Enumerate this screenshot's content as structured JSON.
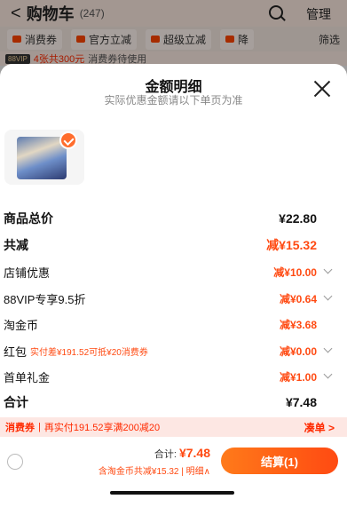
{
  "cart_header": {
    "back": "<",
    "title": "购物车",
    "count": "(247)",
    "manage": "管理"
  },
  "filters": {
    "items": [
      "消费券",
      "官方立减",
      "超级立减",
      "降"
    ],
    "more": "筛选"
  },
  "coupon_banner": {
    "tag": "88VIP",
    "red": "4张共300元",
    "text": "消费券待使用"
  },
  "sheet": {
    "title": "金额明细",
    "subtitle": "实际优惠金额请以下单页为准",
    "rows": [
      {
        "label": "商品总价",
        "value": "¥22.80"
      },
      {
        "label": "共减",
        "value": "减¥15.32"
      },
      {
        "label": "店铺优惠",
        "value": "减¥10.00"
      },
      {
        "label": "88VIP专享9.5折",
        "value": "减¥0.64"
      },
      {
        "label": "淘金币",
        "value": "减¥3.68"
      },
      {
        "label": "红包",
        "note": "实付差¥191.52可抵¥20消费券",
        "value": "减¥0.00"
      },
      {
        "label": "首单礼金",
        "value": "减¥1.00"
      },
      {
        "label": "合计",
        "value": "¥7.48"
      }
    ]
  },
  "promo": {
    "label": "消费券",
    "text": "再实付191.52享满200减20",
    "link": "凑单 >"
  },
  "bottom": {
    "total_label": "合计:",
    "total_value": "¥7.48",
    "sub": "含淘金币共减¥15.32",
    "detail": "明细∧",
    "checkout": "结算(1)"
  },
  "colors": {
    "accent": "#ff4a12",
    "checkout_start": "#ff7a1a"
  }
}
